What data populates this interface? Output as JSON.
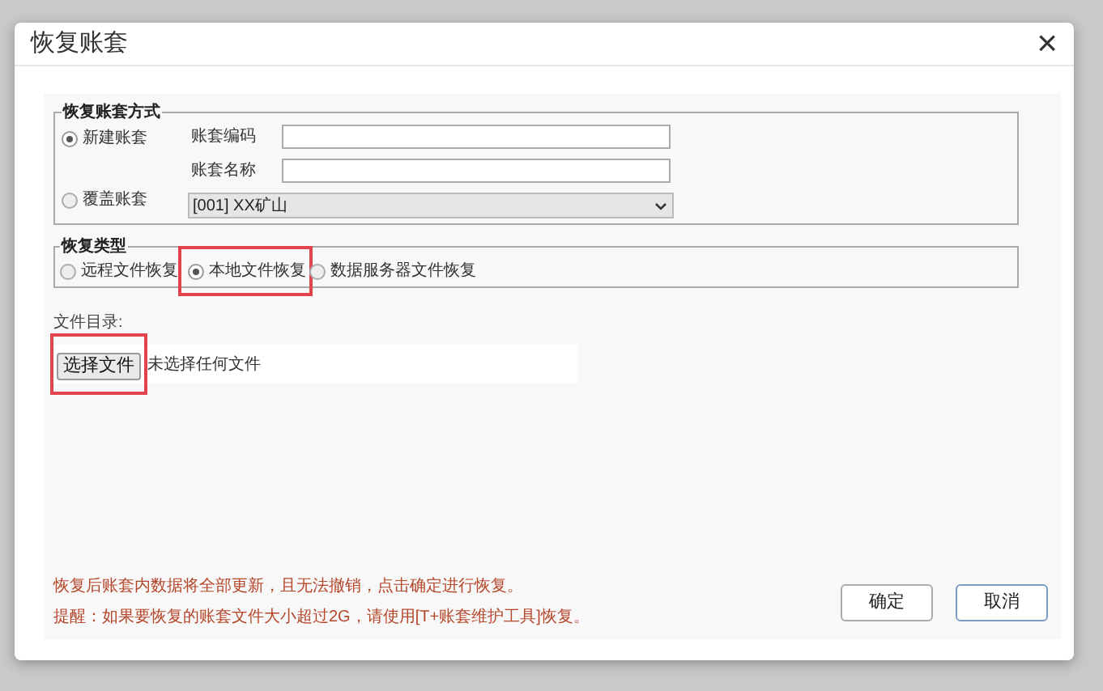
{
  "dialog": {
    "title": "恢复账套",
    "close": "×"
  },
  "restore_method": {
    "legend": "恢复账套方式",
    "options": [
      {
        "label": "新建账套",
        "selected": true
      },
      {
        "label": "覆盖账套",
        "selected": false
      }
    ],
    "fields": [
      {
        "label": "账套编码"
      },
      {
        "label": "账套名称"
      }
    ],
    "dropdown": {
      "value": "[001] XX矿山"
    }
  },
  "restore_type": {
    "legend": "恢复类型",
    "options": [
      {
        "label": "远程文件恢复",
        "selected": false,
        "highlighted": false
      },
      {
        "label": "本地文件恢复",
        "selected": true,
        "highlighted": true
      },
      {
        "label": "数据服务器文件恢复",
        "selected": false,
        "highlighted": false
      }
    ]
  },
  "file": {
    "label": "文件目录:",
    "button": "选择文件",
    "button_highlighted": true,
    "status": "未选择任何文件"
  },
  "notes": [
    "恢复后账套内数据将全部更新，且无法撤销，点击确定进行恢复。",
    "提醒：如果要恢复的账套文件大小超过2G，请使用[T+账套维护工具]恢复。"
  ],
  "buttons": [
    "确定",
    "取消"
  ]
}
